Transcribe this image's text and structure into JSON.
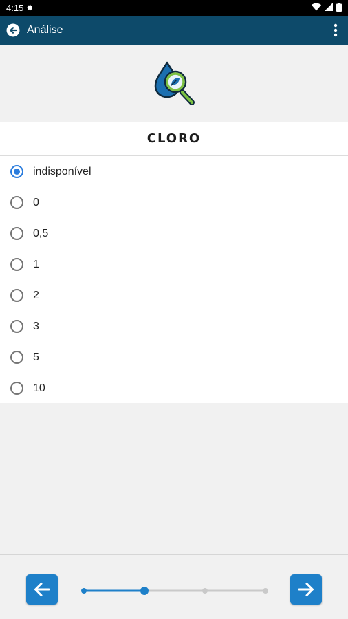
{
  "status_bar": {
    "time": "4:15"
  },
  "app_bar": {
    "title": "Análise"
  },
  "parameter": {
    "title": "CLORO"
  },
  "options": [
    {
      "label": "indisponível",
      "selected": true
    },
    {
      "label": "0",
      "selected": false
    },
    {
      "label": "0,5",
      "selected": false
    },
    {
      "label": "1",
      "selected": false
    },
    {
      "label": "2",
      "selected": false
    },
    {
      "label": "3",
      "selected": false
    },
    {
      "label": "5",
      "selected": false
    },
    {
      "label": "10",
      "selected": false
    }
  ],
  "progress": {
    "steps": 4,
    "current": 2
  },
  "colors": {
    "app_bar": "#0d4a6a",
    "accent": "#2a7cdd",
    "nav_button": "#1e80c9",
    "progress_active": "#1e80c9",
    "progress_inactive": "#c9c9c9"
  },
  "icons": {
    "header": "water-drop-magnifier-icon",
    "back": "back-arrow-icon",
    "menu": "more-vert-icon",
    "prev": "arrow-left-icon",
    "next": "arrow-right-icon"
  }
}
